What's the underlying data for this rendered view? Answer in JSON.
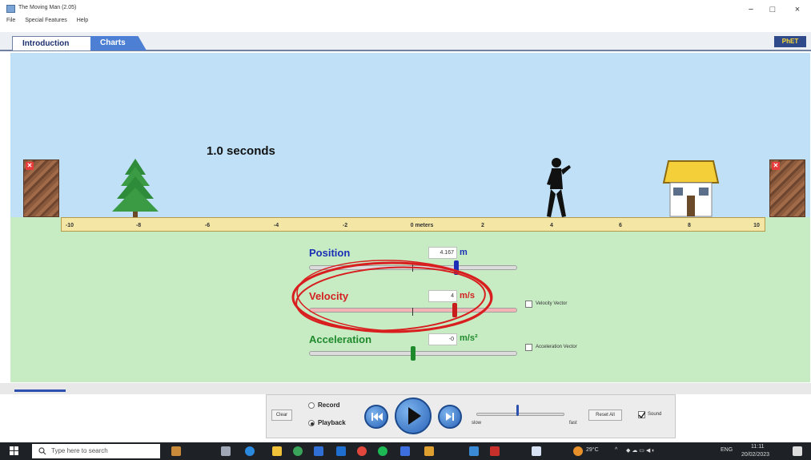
{
  "window": {
    "title": "The Moving Man (2.05)",
    "minimize": "−",
    "maximize": "□",
    "close": "×"
  },
  "menu": [
    "File",
    "Special Features",
    "Help"
  ],
  "tabs": [
    {
      "label": "Introduction",
      "active": true
    },
    {
      "label": "Charts",
      "active": false
    }
  ],
  "logo_text": "PhET",
  "scene": {
    "time_label": "1.0 seconds",
    "ruler_labels": [
      "-10",
      "-8",
      "-6",
      "-4",
      "-2",
      "0 meters",
      "2",
      "4",
      "6",
      "8",
      "10"
    ],
    "man_position_m": 4.167
  },
  "controls": {
    "position": {
      "label": "Position",
      "value": "4.167",
      "unit": "m",
      "color": "#1a2fb5"
    },
    "velocity": {
      "label": "Velocity",
      "value": "4",
      "unit": "m/s",
      "color": "#d42020",
      "vector_label": "Velocity Vector"
    },
    "acceleration": {
      "label": "Acceleration",
      "value": "-0",
      "unit": "m/s²",
      "color": "#1f8a2c",
      "vector_label": "Acceleration Vector"
    }
  },
  "playback": {
    "clear": "Clear",
    "record": "Record",
    "playback": "Playback",
    "mode": "Playback",
    "slow": "slow",
    "fast": "fast",
    "reset_all": "Reset All",
    "sound": "Sound",
    "sound_checked": true
  },
  "taskbar": {
    "search_placeholder": "Type here to search",
    "temperature": "29°C",
    "language": "ENG",
    "time": "11:11",
    "date": "20/02/2023"
  }
}
